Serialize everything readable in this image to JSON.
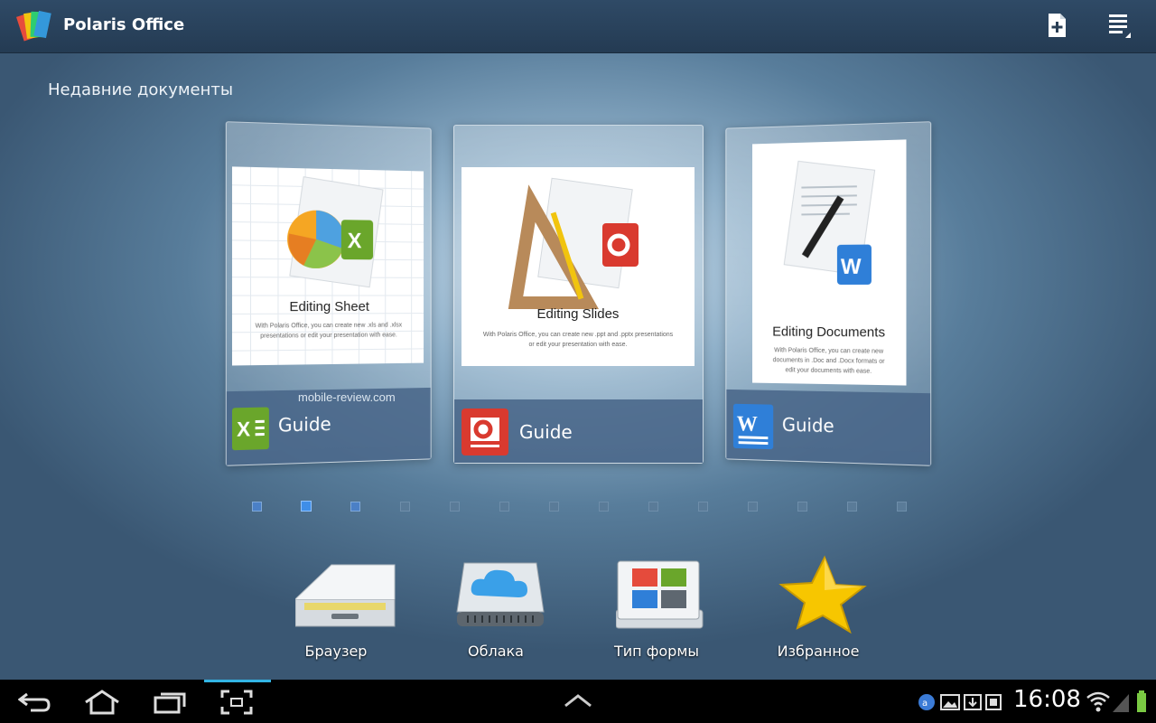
{
  "app": {
    "title": "Polaris Office"
  },
  "toolbar": {
    "new_icon": "new-document-icon",
    "menu_icon": "menu-icon"
  },
  "recent": {
    "title": "Недавние документы",
    "cards": [
      {
        "thumb_title": "Editing Sheet",
        "thumb_body": "With Polaris Office, you can create new .xls and .xlsx presentations or edit your presentation with ease.",
        "label": "Guide",
        "app": "excel",
        "color": "#6aa62b"
      },
      {
        "thumb_title": "Editing Slides",
        "thumb_body": "With Polaris Office, you can create new .ppt and .pptx presentations or edit your presentation with ease.",
        "label": "Guide",
        "app": "powerpoint",
        "color": "#d93a2f"
      },
      {
        "thumb_title": "Editing Documents",
        "thumb_body": "With Polaris Office, you can create new documents in .Doc and .Docx formats or edit your documents with ease.",
        "label": "Guide",
        "app": "word",
        "color": "#2f7fd8"
      }
    ]
  },
  "pager": {
    "count": 14,
    "active": 1
  },
  "watermark": "mobile-review.com",
  "dock": [
    {
      "label": "Браузер",
      "icon": "drive-icon"
    },
    {
      "label": "Облака",
      "icon": "cloud-icon"
    },
    {
      "label": "Тип формы",
      "icon": "templates-icon"
    },
    {
      "label": "Избранное",
      "icon": "star-icon"
    }
  ],
  "status": {
    "time": "16:08",
    "colors": {
      "accent": "#33b5e5",
      "battery": "#7ac943"
    }
  }
}
